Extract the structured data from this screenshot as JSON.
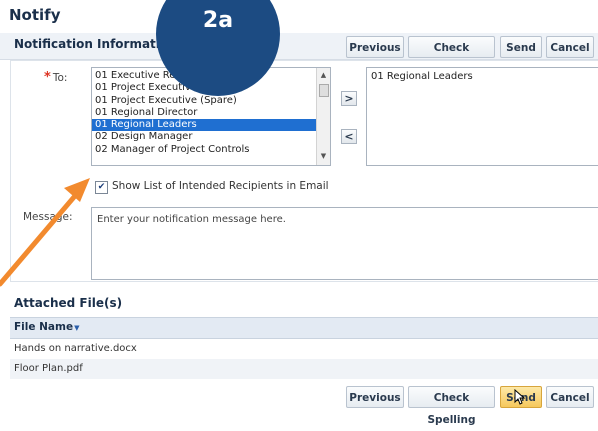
{
  "page": {
    "title": "Notify"
  },
  "badge": {
    "label": "2a"
  },
  "section": {
    "title": "Notification Information"
  },
  "toolbar": {
    "previous": "Previous",
    "check_spelling": "Check Spelling",
    "send": "Send",
    "cancel": "Cancel"
  },
  "to_field": {
    "required_mark": "*",
    "label": "To:",
    "options": [
      "01 Executive Review (Spare)",
      "01 Project Executive",
      "01 Project Executive (Spare)",
      "01 Regional Director",
      "01 Regional Leaders",
      "02 Design Manager",
      "02 Manager of Project Controls"
    ],
    "selected_index": 4,
    "add_symbol": ">",
    "remove_symbol": "<",
    "selected_recipients": [
      "01 Regional Leaders"
    ]
  },
  "show_list": {
    "checked": true,
    "label": "Show List of Intended Recipients in Email"
  },
  "message": {
    "label": "Message:",
    "placeholder": "Enter your notification message here."
  },
  "attached": {
    "title": "Attached File(s)",
    "column_header": "File Name",
    "files": [
      "Hands on narrative.docx",
      "Floor Plan.pdf"
    ]
  },
  "icons": {
    "scroll_up": "scroll-up-arrow",
    "scroll_down": "scroll-down-arrow",
    "sort": "sort-down-icon",
    "checkbox": "checkmark",
    "pointer": "mouse-cursor"
  },
  "colors": {
    "badge": "#1c4b82",
    "arrow": "#f28a2e",
    "selection": "#1f6fd1",
    "active_button": "#f6c85c"
  }
}
